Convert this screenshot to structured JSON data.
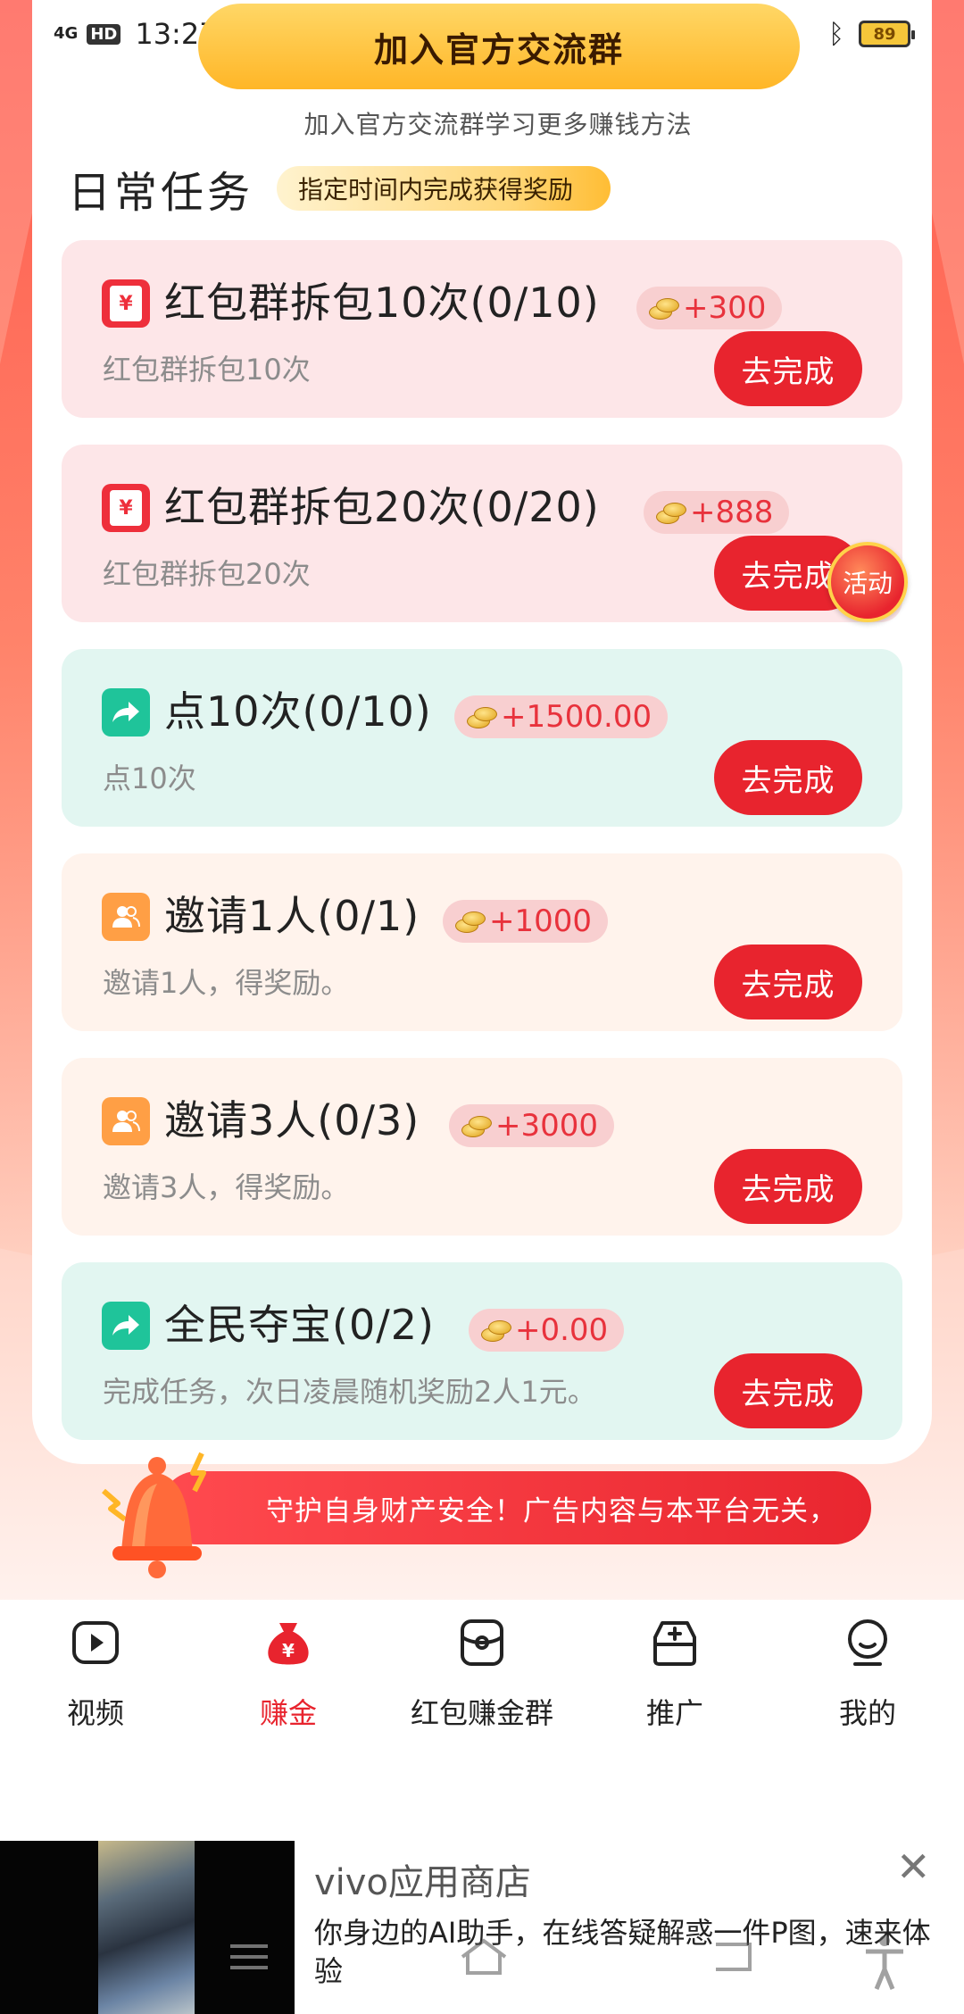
{
  "status_bar": {
    "network": "4G",
    "time": "13:27",
    "battery": "89"
  },
  "header": {
    "join_button": "加入官方交流群",
    "join_subtitle": "加入官方交流群学习更多赚钱方法"
  },
  "daily_tasks": {
    "title": "日常任务",
    "tag": "指定时间内完成获得奖励",
    "items": [
      {
        "title": "红包群拆包10次(0/10)",
        "reward": "+300",
        "desc": "红包群拆包10次",
        "button": "去完成",
        "icon": "red-envelope-icon"
      },
      {
        "title": "红包群拆包20次(0/20)",
        "reward": "+888",
        "desc": "红包群拆包20次",
        "button": "去完成",
        "icon": "red-envelope-icon"
      },
      {
        "title": "点10次(0/10)",
        "reward": "+1500.00",
        "desc": "点10次",
        "button": "去完成",
        "icon": "share-arrow-icon"
      },
      {
        "title": "邀请1人(0/1)",
        "reward": "+1000",
        "desc": "邀请1人，得奖励。",
        "button": "去完成",
        "icon": "users-icon"
      },
      {
        "title": "邀请3人(0/3)",
        "reward": "+3000",
        "desc": "邀请3人，得奖励。",
        "button": "去完成",
        "icon": "users-icon"
      },
      {
        "title": "全民夺宝(0/2)",
        "reward": "+0.00",
        "desc": "完成任务，次日凌晨随机奖励2人1元。",
        "button": "去完成",
        "icon": "share-arrow-icon"
      }
    ],
    "activity_badge": "活动"
  },
  "warning_banner": "守护自身财产安全！广告内容与本平台无关，",
  "bottom_nav": {
    "items": [
      {
        "label": "视频",
        "icon": "video-play-icon"
      },
      {
        "label": "赚金",
        "icon": "money-bag-icon"
      },
      {
        "label": "红包赚金群",
        "icon": "red-packet-group-icon"
      },
      {
        "label": "推广",
        "icon": "promote-box-icon"
      },
      {
        "label": "我的",
        "icon": "profile-icon"
      }
    ],
    "active_index": 1
  },
  "ad": {
    "title": "vivo应用商店",
    "description": "你身边的AI助手，在线答疑解惑一件P图，速来体验"
  },
  "colors": {
    "accent_red": "#e8242e",
    "gold": "#ffb627"
  }
}
